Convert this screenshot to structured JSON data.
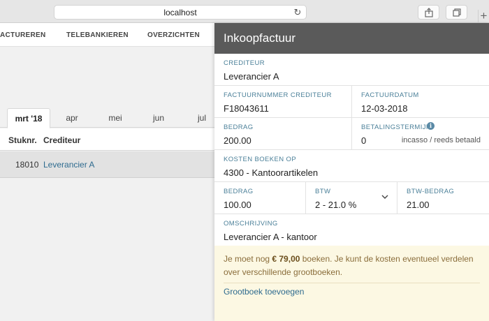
{
  "browser": {
    "url": "localhost",
    "reload_icon": "reload-icon",
    "share_icon": "share-icon",
    "tabs_icon": "tabs-icon",
    "newtab_label": "+"
  },
  "nav": {
    "items": [
      {
        "label": "ACTUREREN"
      },
      {
        "label": "TELEBANKIEREN"
      },
      {
        "label": "OVERZICHTEN"
      }
    ]
  },
  "months": {
    "tabs": [
      {
        "label": "mrt '18",
        "active": true
      },
      {
        "label": "apr"
      },
      {
        "label": "mei"
      },
      {
        "label": "jun"
      },
      {
        "label": "jul"
      }
    ]
  },
  "table": {
    "columns": [
      "Stuknr.",
      "Crediteur"
    ],
    "rows": [
      {
        "stuknr": "18010",
        "crediteur": "Leverancier A"
      }
    ]
  },
  "panel": {
    "title": "Inkoopfactuur",
    "crediteur": {
      "label": "CREDITEUR",
      "value": "Leverancier A"
    },
    "factuurnummer": {
      "label": "FACTUURNUMMER CREDITEUR",
      "value": "F18043611"
    },
    "factuurdatum": {
      "label": "FACTUURDATUM",
      "value": "12-03-2018"
    },
    "bedrag": {
      "label": "BEDRAG",
      "value": "200.00"
    },
    "betalingstermijn": {
      "label": "BETALINGSTERMIJN",
      "value": "0",
      "hint": "incasso / reeds betaald"
    },
    "kosten_boeken_op": {
      "label": "KOSTEN BOEKEN OP",
      "value": "4300 - Kantoorartikelen"
    },
    "regel": {
      "bedrag": {
        "label": "BEDRAG",
        "value": "100.00"
      },
      "btw": {
        "label": "BTW",
        "value": "2 - 21.0 %"
      },
      "btw_bedrag": {
        "label": "BTW-BEDRAG",
        "value": "21.00"
      }
    },
    "omschrijving": {
      "label": "OMSCHRIJVING",
      "value": "Leverancier A - kantoor"
    },
    "notice": {
      "text_before": "Je moet nog ",
      "amount": "€ 79,00",
      "text_after": " boeken. Je kunt de kosten eventueel verdelen over verschillende grootboeken.",
      "link": "Grootboek toevoegen"
    }
  },
  "colors": {
    "header": "#5a5a5a",
    "label": "#4a7f98",
    "link": "#2e6b8f",
    "notice_bg": "#fcf8e3",
    "notice_text": "#8a6d3b"
  }
}
